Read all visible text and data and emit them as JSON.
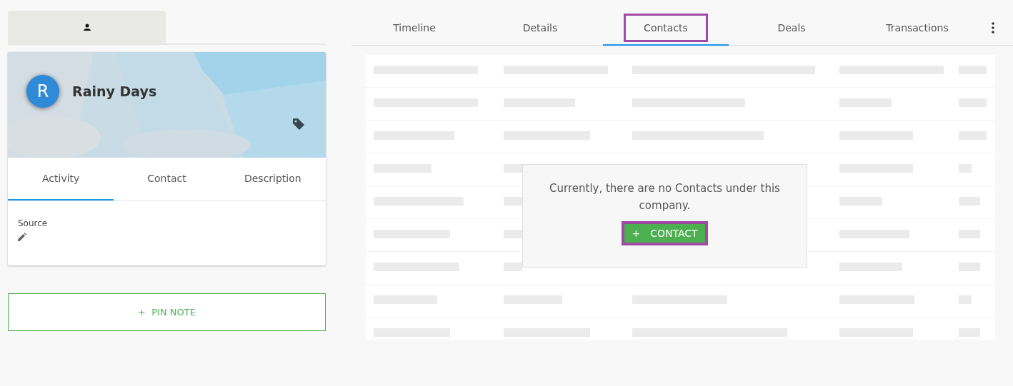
{
  "side_tabs": [
    {
      "kind": "person",
      "selected": true
    }
  ],
  "company": {
    "initial": "R",
    "name": "Rainy Days"
  },
  "card_tabs": [
    {
      "label": "Activity",
      "selected": true
    },
    {
      "label": "Contact",
      "selected": false
    },
    {
      "label": "Description",
      "selected": false
    }
  ],
  "fields": [
    {
      "label": "Source"
    }
  ],
  "pin_note": {
    "label": "PIN NOTE"
  },
  "tabs": [
    {
      "label": "Timeline",
      "selected": false,
      "highlighted": false
    },
    {
      "label": "Details",
      "selected": false,
      "highlighted": false
    },
    {
      "label": "Contacts",
      "selected": true,
      "highlighted": true
    },
    {
      "label": "Deals",
      "selected": false,
      "highlighted": false
    },
    {
      "label": "Transactions",
      "selected": false,
      "highlighted": false
    }
  ],
  "empty_state": {
    "message": "Currently, there are no Contacts under this company.",
    "button": {
      "icon": "+",
      "label": "CONTACT",
      "highlighted": true
    }
  }
}
